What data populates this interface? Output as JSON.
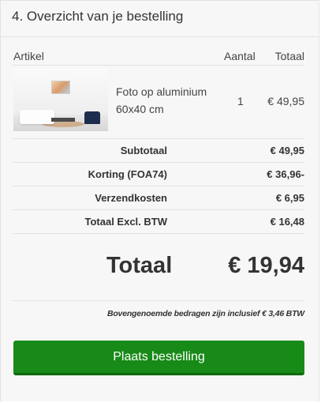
{
  "panel": {
    "title": "4. Overzicht van je bestelling"
  },
  "table": {
    "headers": {
      "article": "Artikel",
      "quantity": "Aantal",
      "total": "Totaal"
    },
    "items": [
      {
        "name": "Foto op aluminium 60x40 cm",
        "quantity": "1",
        "total": "€ 49,95"
      }
    ]
  },
  "summary": {
    "rows": [
      {
        "label": "Subtotaal",
        "value": "€ 49,95"
      },
      {
        "label": "Korting (FOA74)",
        "value": "€ 36,96-"
      },
      {
        "label": "Verzendkosten",
        "value": "€ 6,95"
      },
      {
        "label": "Totaal Excl. BTW",
        "value": "€ 16,48"
      }
    ],
    "grand_total_label": "Totaal",
    "grand_total_value": "€ 19,94",
    "vat_note": "Bovengenoemde bedragen zijn inclusief € 3,46 BTW"
  },
  "actions": {
    "place_order_label": "Plaats bestelling"
  },
  "colors": {
    "primary_button": "#178a17",
    "panel_background": "#f7f7f7"
  }
}
